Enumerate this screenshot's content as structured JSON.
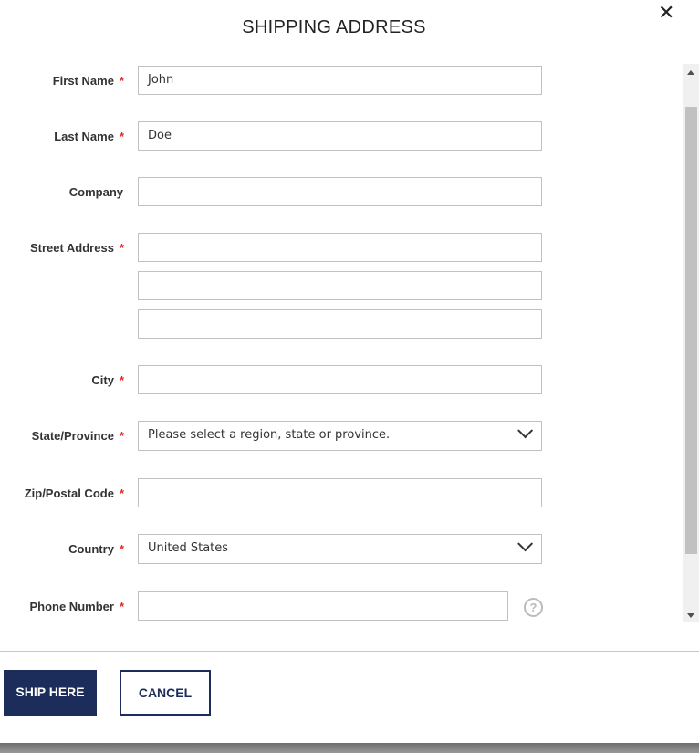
{
  "modal": {
    "title": "SHIPPING ADDRESS",
    "close_icon": "close-icon"
  },
  "form": {
    "first_name": {
      "label": "First Name",
      "required": "*",
      "value": "John"
    },
    "last_name": {
      "label": "Last Name",
      "required": "*",
      "value": "Doe"
    },
    "company": {
      "label": "Company",
      "value": ""
    },
    "street": {
      "label": "Street Address",
      "required": "*",
      "line1": "",
      "line2": "",
      "line3": ""
    },
    "city": {
      "label": "City",
      "required": "*",
      "value": ""
    },
    "state": {
      "label": "State/Province",
      "required": "*",
      "value": "Please select a region, state or province."
    },
    "zip": {
      "label": "Zip/Postal Code",
      "required": "*",
      "value": ""
    },
    "country": {
      "label": "Country",
      "required": "*",
      "value": "United States"
    },
    "phone": {
      "label": "Phone Number",
      "required": "*",
      "value": "",
      "help_icon": "?"
    }
  },
  "actions": {
    "ship_label": "SHIP HERE",
    "cancel_label": "CANCEL"
  },
  "colors": {
    "primary": "#1c2c5b",
    "required": "#e02b27"
  }
}
